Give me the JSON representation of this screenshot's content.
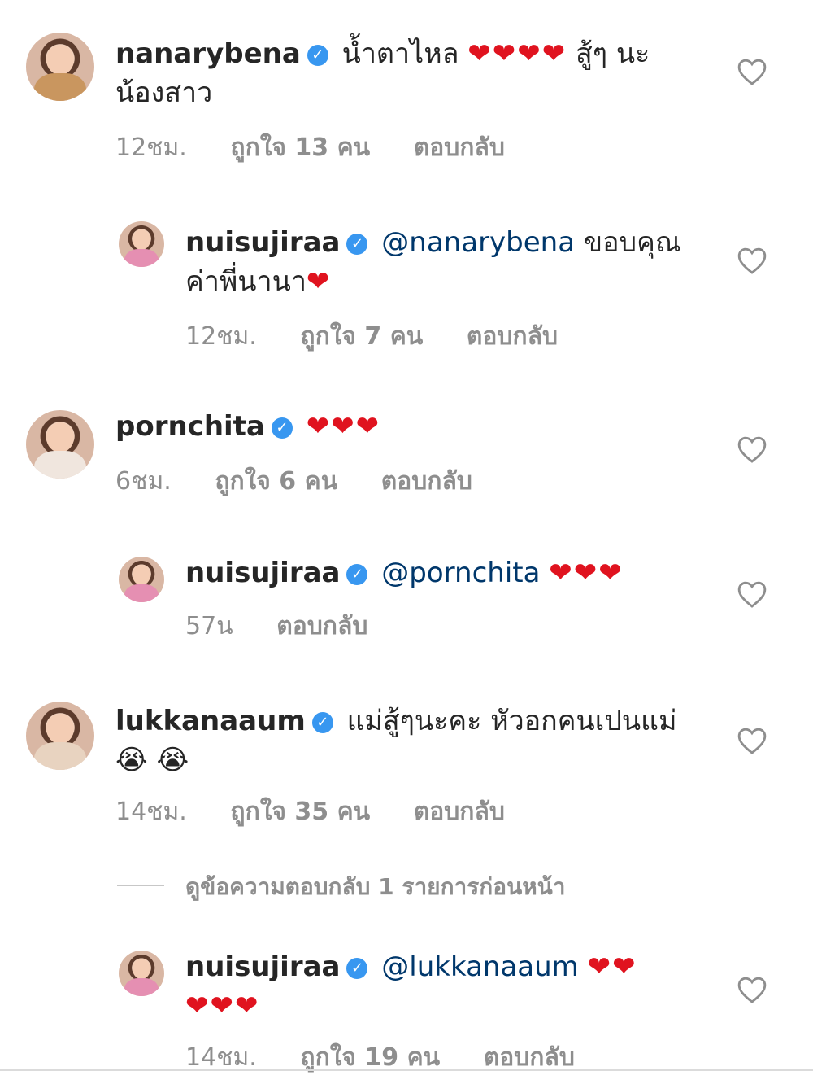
{
  "comments": [
    {
      "username": "nanarybena",
      "text_before": "น้ำตาไหล",
      "hearts": "❤❤❤❤",
      "text_after": "สู้ๆ นะน้องสาว",
      "time": "12ชม.",
      "likes": "ถูกใจ 13 คน",
      "reply": "ตอบกลับ"
    },
    {
      "username": "nuisujiraa",
      "mention": "@nanarybena",
      "text": "ขอบคุณค่าพี่นานา",
      "hearts": "❤",
      "time": "12ชม.",
      "likes": "ถูกใจ 7 คน",
      "reply": "ตอบกลับ"
    },
    {
      "username": "pornchita",
      "hearts": "❤❤❤",
      "time": "6ชม.",
      "likes": "ถูกใจ 6 คน",
      "reply": "ตอบกลับ"
    },
    {
      "username": "nuisujiraa",
      "mention": "@pornchita",
      "hearts": "❤❤❤",
      "time": "57น",
      "reply": "ตอบกลับ"
    },
    {
      "username": "lukkanaaum",
      "text": "แม่สู้ๆนะคะ หัวอกคนเปนแม่",
      "emoji": "😭 😭",
      "time": "14ชม.",
      "likes": "ถูกใจ 35 คน",
      "reply": "ตอบกลับ"
    },
    {
      "username": "nuisujiraa",
      "mention": "@lukkanaaum",
      "hearts_line1": "❤❤",
      "hearts_line2": "❤❤❤",
      "time": "14ชม.",
      "likes": "ถูกใจ 19 คน",
      "reply": "ตอบกลับ"
    }
  ],
  "view_previous_replies": "ดูข้อความตอบกลับ 1 รายการก่อนหน้า",
  "colors": {
    "verified": "#3897f0",
    "mention": "#00376b",
    "heart": "#e0131f",
    "meta": "#8e8e8e"
  },
  "icons": {
    "verified": "verified-badge-icon",
    "like": "heart-outline-icon"
  }
}
